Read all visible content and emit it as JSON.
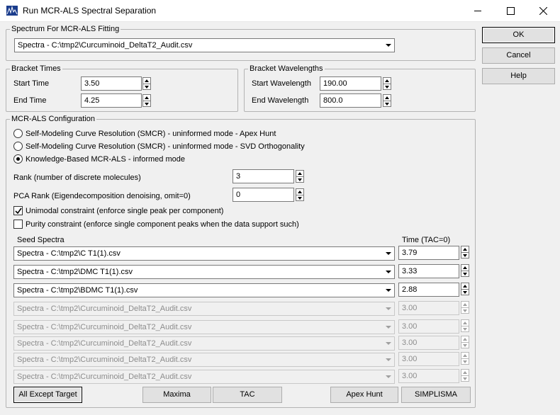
{
  "window": {
    "title": "Run MCR-ALS Spectral Separation"
  },
  "spectrum_group": {
    "label": "Spectrum For MCR-ALS Fitting",
    "selected": "Spectra - C:\\tmp2\\Curcuminoid_DeltaT2_Audit.csv"
  },
  "bracket_times": {
    "label": "Bracket Times",
    "start_label": "Start Time",
    "start_value": "3.50",
    "end_label": "End Time",
    "end_value": "4.25"
  },
  "bracket_wavelengths": {
    "label": "Bracket Wavelengths",
    "start_label": "Start Wavelength",
    "start_value": "190.00",
    "end_label": "End Wavelength",
    "end_value": "800.0"
  },
  "config": {
    "label": "MCR-ALS Configuration",
    "radio_apex": "Self-Modeling Curve Resolution (SMCR) - uninformed mode - Apex Hunt",
    "radio_svd": "Self-Modeling Curve Resolution (SMCR) - uninformed mode - SVD Orthogonality",
    "radio_kb": "Knowledge-Based MCR-ALS - informed mode",
    "rank_label": "Rank (number of discrete molecules)",
    "rank_value": "3",
    "pca_label": "PCA Rank (Eigendecomposition denoising, omit=0)",
    "pca_value": "0",
    "unimodal_label": "Unimodal constraint (enforce single peak per component)",
    "purity_label": "Purity constraint (enforce single component peaks when the data support such)",
    "seed_header": "Seed Spectra",
    "time_header": "Time (TAC=0)"
  },
  "seeds": [
    {
      "spectrum": "Spectra - C:\\tmp2\\C T1(1).csv",
      "time": "3.79"
    },
    {
      "spectrum": "Spectra - C:\\tmp2\\DMC T1(1).csv",
      "time": "3.33"
    },
    {
      "spectrum": "Spectra - C:\\tmp2\\BDMC T1(1).csv",
      "time": "2.88"
    },
    {
      "spectrum": "Spectra - C:\\tmp2\\Curcuminoid_DeltaT2_Audit.csv",
      "time": "3.00"
    },
    {
      "spectrum": "Spectra - C:\\tmp2\\Curcuminoid_DeltaT2_Audit.csv",
      "time": "3.00"
    },
    {
      "spectrum": "Spectra - C:\\tmp2\\Curcuminoid_DeltaT2_Audit.csv",
      "time": "3.00"
    },
    {
      "spectrum": "Spectra - C:\\tmp2\\Curcuminoid_DeltaT2_Audit.csv",
      "time": "3.00"
    },
    {
      "spectrum": "Spectra - C:\\tmp2\\Curcuminoid_DeltaT2_Audit.csv",
      "time": "3.00"
    }
  ],
  "buttons": {
    "ok": "OK",
    "cancel": "Cancel",
    "help": "Help",
    "all_except": "All Except Target",
    "maxima": "Maxima",
    "tac": "TAC",
    "apex_hunt": "Apex Hunt",
    "simplisma": "SIMPLISMA"
  },
  "icons": {
    "app": "chart-window-icon",
    "minimize": "minimize-icon",
    "maximize": "maximize-icon",
    "close": "close-icon"
  }
}
